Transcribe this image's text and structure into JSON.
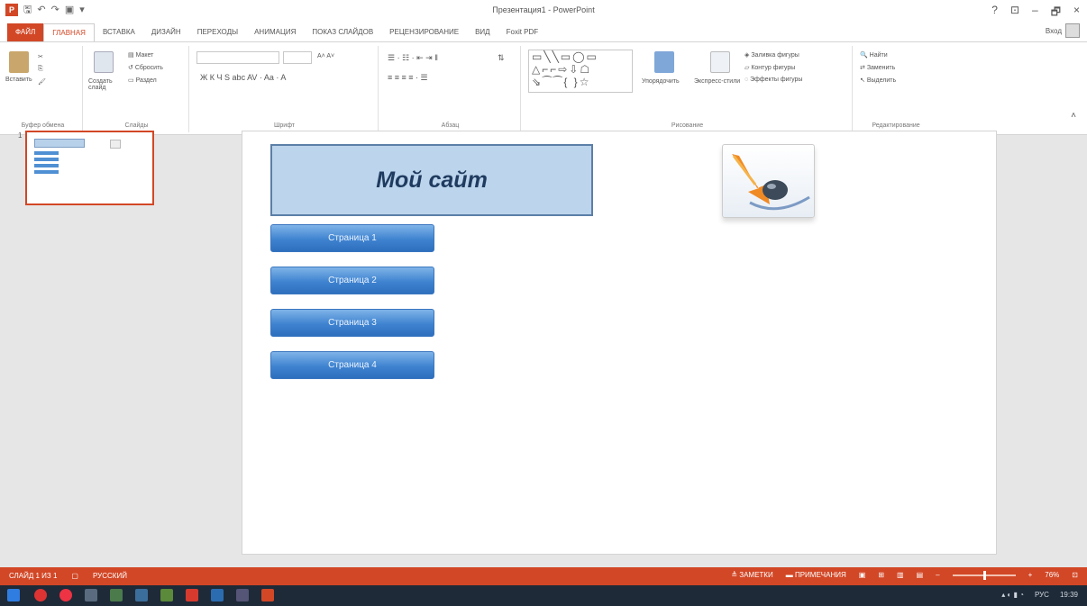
{
  "titlebar": {
    "title": "Презентация1 - PowerPoint",
    "qat": [
      "save-icon",
      "undo-icon",
      "redo-icon",
      "start-from-beginning-icon"
    ],
    "controls": [
      "?",
      "⊡",
      "–",
      "🗗",
      "×"
    ]
  },
  "tabs": [
    "ФАЙЛ",
    "ГЛАВНАЯ",
    "ВСТАВКА",
    "ДИЗАЙН",
    "ПЕРЕХОДЫ",
    "АНИМАЦИЯ",
    "ПОКАЗ СЛАЙДОВ",
    "РЕЦЕНЗИРОВАНИЕ",
    "ВИД",
    "Foxit PDF"
  ],
  "user": "Вход",
  "ribbon": {
    "clipboard": {
      "paste": "Вставить",
      "name": "Буфер обмена"
    },
    "slides": {
      "new_slide": "Создать слайд",
      "layout": "Макет",
      "reset": "Сбросить",
      "section": "Раздел",
      "name": "Слайды"
    },
    "font": {
      "name": "Шрифт"
    },
    "paragraph": {
      "name": "Абзац"
    },
    "drawing": {
      "arrange": "Упорядочить",
      "quick_styles": "Экспресс-стили",
      "fill": "Заливка фигуры",
      "outline": "Контур фигуры",
      "effects": "Эффекты фигуры",
      "name": "Рисование"
    },
    "editing": {
      "find": "Найти",
      "replace": "Заменить",
      "select": "Выделить",
      "name": "Редактирование"
    }
  },
  "thumbnail": {
    "number": "1"
  },
  "slide": {
    "title": "Мой сайт",
    "buttons": [
      "Страница 1",
      "Страница 2",
      "Страница 3",
      "Страница 4"
    ]
  },
  "statusbar": {
    "slide_info": "СЛАЙД 1 ИЗ 1",
    "language": "РУССКИЙ",
    "notes": "ЗАМЕТКИ",
    "comments": "ПРИМЕЧАНИЯ",
    "zoom": "76%"
  },
  "taskbar": {
    "lang": "РУС",
    "time": "19:39"
  },
  "colors": {
    "accent": "#d24726",
    "slide_button": "#3f83d0"
  }
}
